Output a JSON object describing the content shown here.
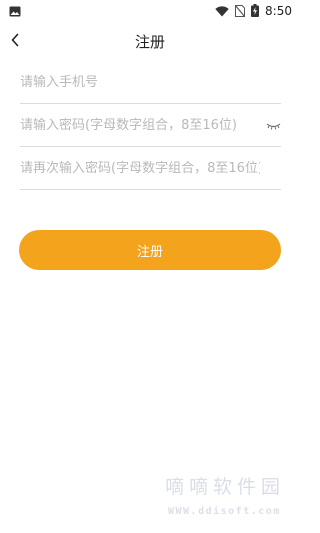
{
  "status_bar": {
    "time": "8:50",
    "icons": [
      "image-icon",
      "wifi-icon",
      "no-sim-icon",
      "battery-charging-icon"
    ]
  },
  "header": {
    "back_icon": "chevron-left-icon",
    "title": "注册"
  },
  "form": {
    "phone_placeholder": "请输入手机号",
    "password_placeholder": "请输入密码(字母数字组合，8至16位)",
    "password_toggle_icon": "eye-closed-icon",
    "confirm_password_placeholder": "请再次输入密码(字母数字组合，8至16位)",
    "register_label": "注册"
  },
  "colors": {
    "accent": "#f3a31c",
    "divider": "#dcdcdc",
    "placeholder": "#b9b9b9"
  },
  "watermark": {
    "title": "嘀嘀软件园",
    "url": "WWW.ddisoft.com"
  }
}
